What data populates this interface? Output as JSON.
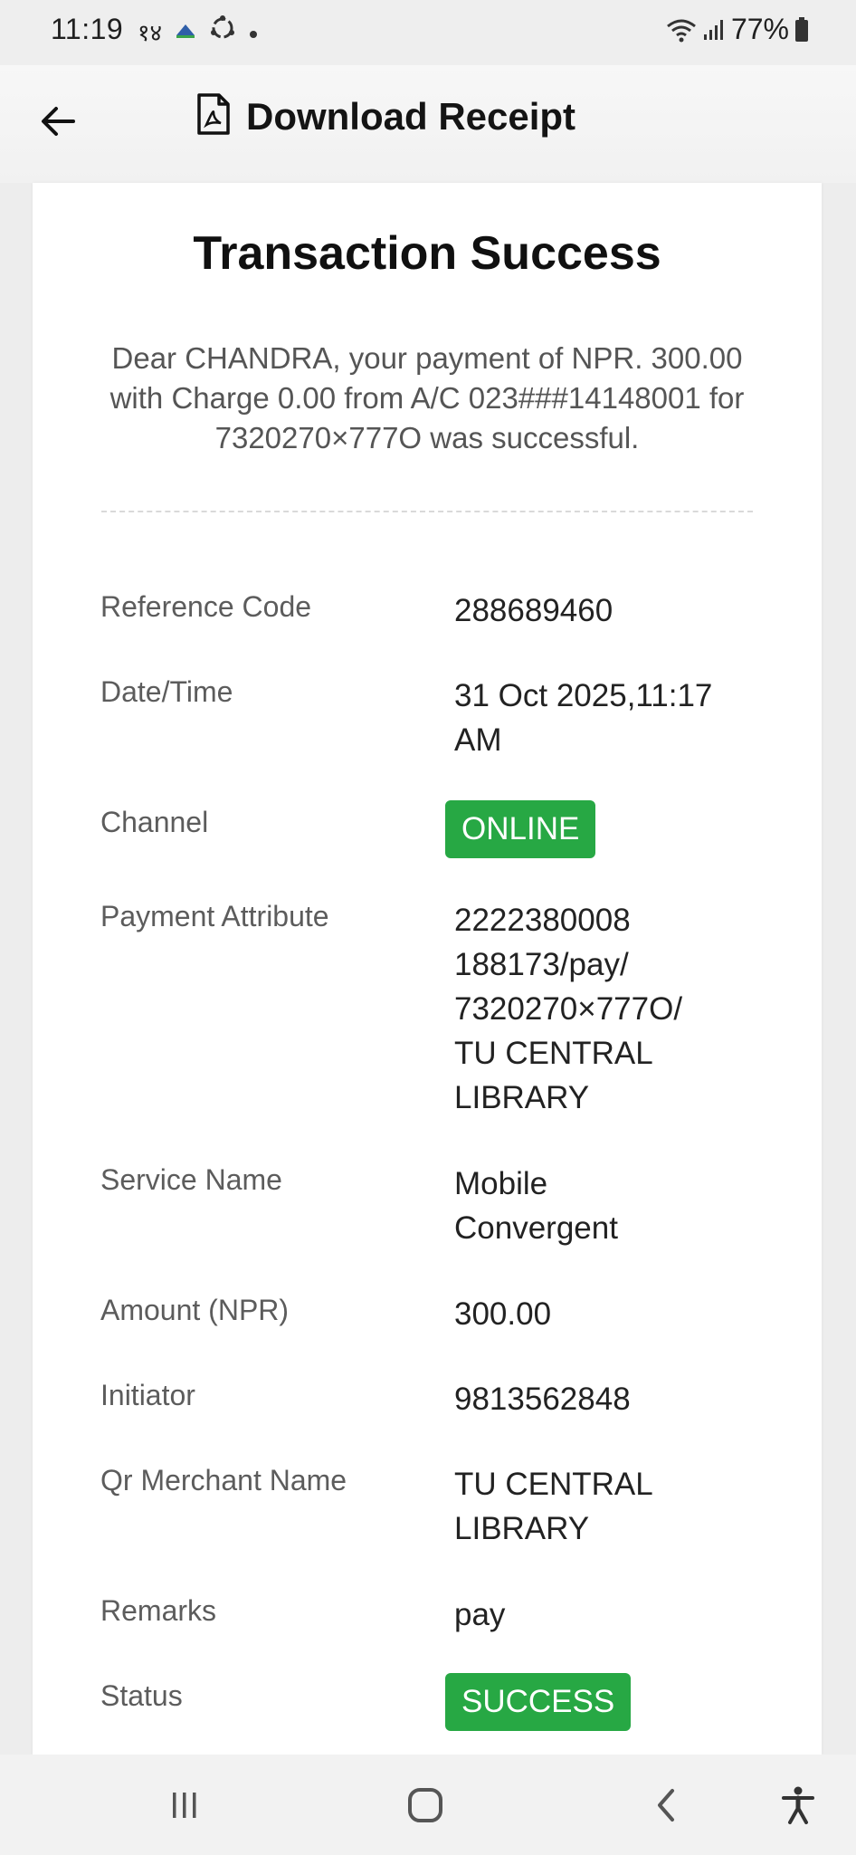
{
  "status_bar": {
    "time": "11:19",
    "extra_text": "१४",
    "battery": "77%"
  },
  "header": {
    "back_icon": "arrow-left-icon",
    "pdf_icon": "pdf-file-icon",
    "title": "Download Receipt"
  },
  "receipt": {
    "title": "Transaction Success",
    "message_lines": [
      "Dear CHANDRA, your payment of NPR. 300.00",
      "with Charge 0.00 from A/C 023###14148001 for",
      "7320270×777O was successful."
    ],
    "details": [
      {
        "label": "Reference Code",
        "value_lines": [
          "288689460"
        ]
      },
      {
        "label": "Date/Time",
        "value_lines": [
          "31 Oct 2025,11:17",
          "AM"
        ]
      },
      {
        "label": "Channel",
        "value_lines": [
          "ONLINE"
        ]
      },
      {
        "label": "Payment Attribute",
        "value_lines": [
          "2222380008",
          "188173/pay/",
          "7320270×777O/",
          "TU CENTRAL",
          "LIBRARY"
        ]
      },
      {
        "label": "Service Name",
        "value_lines": [
          "Mobile",
          "Convergent"
        ]
      },
      {
        "label": "Amount (NPR)",
        "value_lines": [
          "300.00"
        ]
      },
      {
        "label": "Initiator",
        "value_lines": [
          "9813562848"
        ]
      },
      {
        "label": "Qr Merchant Name",
        "value_lines": [
          "TU CENTRAL",
          "LIBRARY"
        ]
      },
      {
        "label": "Remarks",
        "value_lines": [
          "pay"
        ]
      },
      {
        "label": "Status",
        "value_lines": [
          "SUCCESS"
        ]
      }
    ]
  },
  "colors": {
    "badge_green": "#27a844",
    "background": "#ededed"
  },
  "nav_bar": {
    "recent_icon": "recent-apps-icon",
    "home_icon": "home-icon",
    "back_icon": "nav-back-icon",
    "accessibility_icon": "accessibility-icon"
  }
}
